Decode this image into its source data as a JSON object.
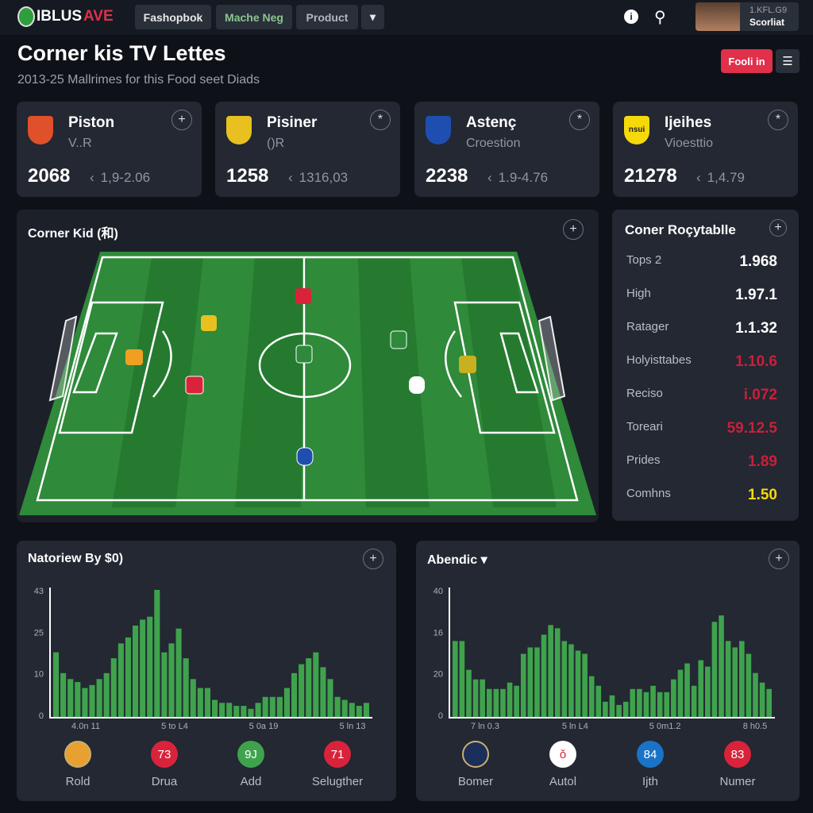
{
  "nav": {
    "brand_a": "IBLUS",
    "brand_b": "AVE",
    "tabs": [
      "Fashopbok",
      "Mache Neg",
      "Product"
    ],
    "more": "▾",
    "user_line1": "1.KFL.G9",
    "user_line2": "Scorliat"
  },
  "header": {
    "title": "Corner kis TV Lettes",
    "subtitle": "2013-25 Mallrimes for this Food seet Diads",
    "action": "Fooli in",
    "menu": "☰"
  },
  "colors": {
    "accent": "#e0304a",
    "green": "#3fa34d",
    "yellow": "#f5d90a",
    "red": "#d9233b",
    "blue": "#1a73c8"
  },
  "teams": [
    {
      "name": "Piston",
      "sub": "V..R",
      "value": "2068",
      "range": "1,9-2.06",
      "action": "+",
      "crest": "#e0502a"
    },
    {
      "name": "Pisiner",
      "sub": "()R",
      "value": "1258",
      "range": "1316,03",
      "action": "*",
      "crest": "#e8c020"
    },
    {
      "name": "Astenç",
      "sub": "Croestion",
      "value": "2238",
      "range": "1.9-4.76",
      "action": "*",
      "crest": "#1e4fb0"
    },
    {
      "name": "Ijeihes",
      "sub": "Vioesttio",
      "value": "21278",
      "range": "1,4.79",
      "action": "*",
      "crest": "#f5d90a",
      "crest_text": "nsui"
    }
  ],
  "field": {
    "title": "Corner Kid (和)",
    "action": "+"
  },
  "table": {
    "title": "Coner Roçytablle",
    "action": "+",
    "rows": [
      {
        "label": "Tops 2",
        "value": "1.968",
        "color": "#ffffff"
      },
      {
        "label": "High",
        "value": "1.97.1",
        "color": "#ffffff"
      },
      {
        "label": "Ratager",
        "value": "1.1.32",
        "color": "#ffffff"
      },
      {
        "label": "Holyisttabes",
        "value": "1.10.6",
        "color": "#c8203a"
      },
      {
        "label": "Reciso",
        "value": "i.072",
        "color": "#c8203a"
      },
      {
        "label": "Toreari",
        "value": "59.12.5",
        "color": "#c8203a"
      },
      {
        "label": "Prides",
        "value": "1.89",
        "color": "#c8203a"
      },
      {
        "label": "Comhns",
        "value": "1.50",
        "color": "#f5d90a"
      }
    ]
  },
  "chart_data": [
    {
      "type": "bar",
      "title": "Natoriew By $0)",
      "action": "+",
      "yticks": [
        "43",
        "25",
        "10",
        "0"
      ],
      "ylim": [
        0,
        43
      ],
      "xticks": [
        "4.0n 11",
        "5 to L4",
        "5 0a 19",
        "5 ln 13"
      ],
      "values": [
        22,
        15,
        13,
        12,
        10,
        11,
        13,
        15,
        20,
        25,
        27,
        31,
        33,
        34,
        43,
        22,
        25,
        30,
        20,
        13,
        10,
        10,
        6,
        5,
        5,
        4,
        4,
        3,
        5,
        7,
        7,
        7,
        10,
        15,
        18,
        20,
        22,
        17,
        13,
        7,
        6,
        5,
        4,
        5
      ],
      "badges": [
        {
          "label": "Rold",
          "text": "",
          "color": "crest"
        },
        {
          "label": "Drua",
          "text": "73",
          "color": "#d9233b"
        },
        {
          "label": "Add",
          "text": "9J",
          "color": "#3fa34d"
        },
        {
          "label": "Selugther",
          "text": "71",
          "color": "#d9233b"
        }
      ]
    },
    {
      "type": "bar",
      "title": "Abendic ▾",
      "action": "+",
      "yticks": [
        "40",
        "16",
        "20",
        "0"
      ],
      "ylim": [
        0,
        40
      ],
      "xticks": [
        "7 ln 0.3",
        "5 ln L4",
        "5 0m1.2",
        "8 h0.5"
      ],
      "values": [
        24,
        24,
        15,
        12,
        12,
        9,
        9,
        9,
        11,
        10,
        20,
        22,
        22,
        26,
        29,
        28,
        24,
        23,
        21,
        20,
        13,
        10,
        5,
        7,
        4,
        5,
        9,
        9,
        8,
        10,
        8,
        8,
        12,
        15,
        17,
        10,
        18,
        16,
        30,
        32,
        24,
        22,
        24,
        20,
        14,
        11,
        9
      ],
      "badges": [
        {
          "label": "Bomer",
          "text": "",
          "color": "crest"
        },
        {
          "label": "Autol",
          "text": "ǒ",
          "color": "#ffffff"
        },
        {
          "label": "Ijth",
          "text": "84",
          "color": "#1a73c8"
        },
        {
          "label": "Numer",
          "text": "83",
          "color": "#d9233b"
        }
      ]
    }
  ]
}
